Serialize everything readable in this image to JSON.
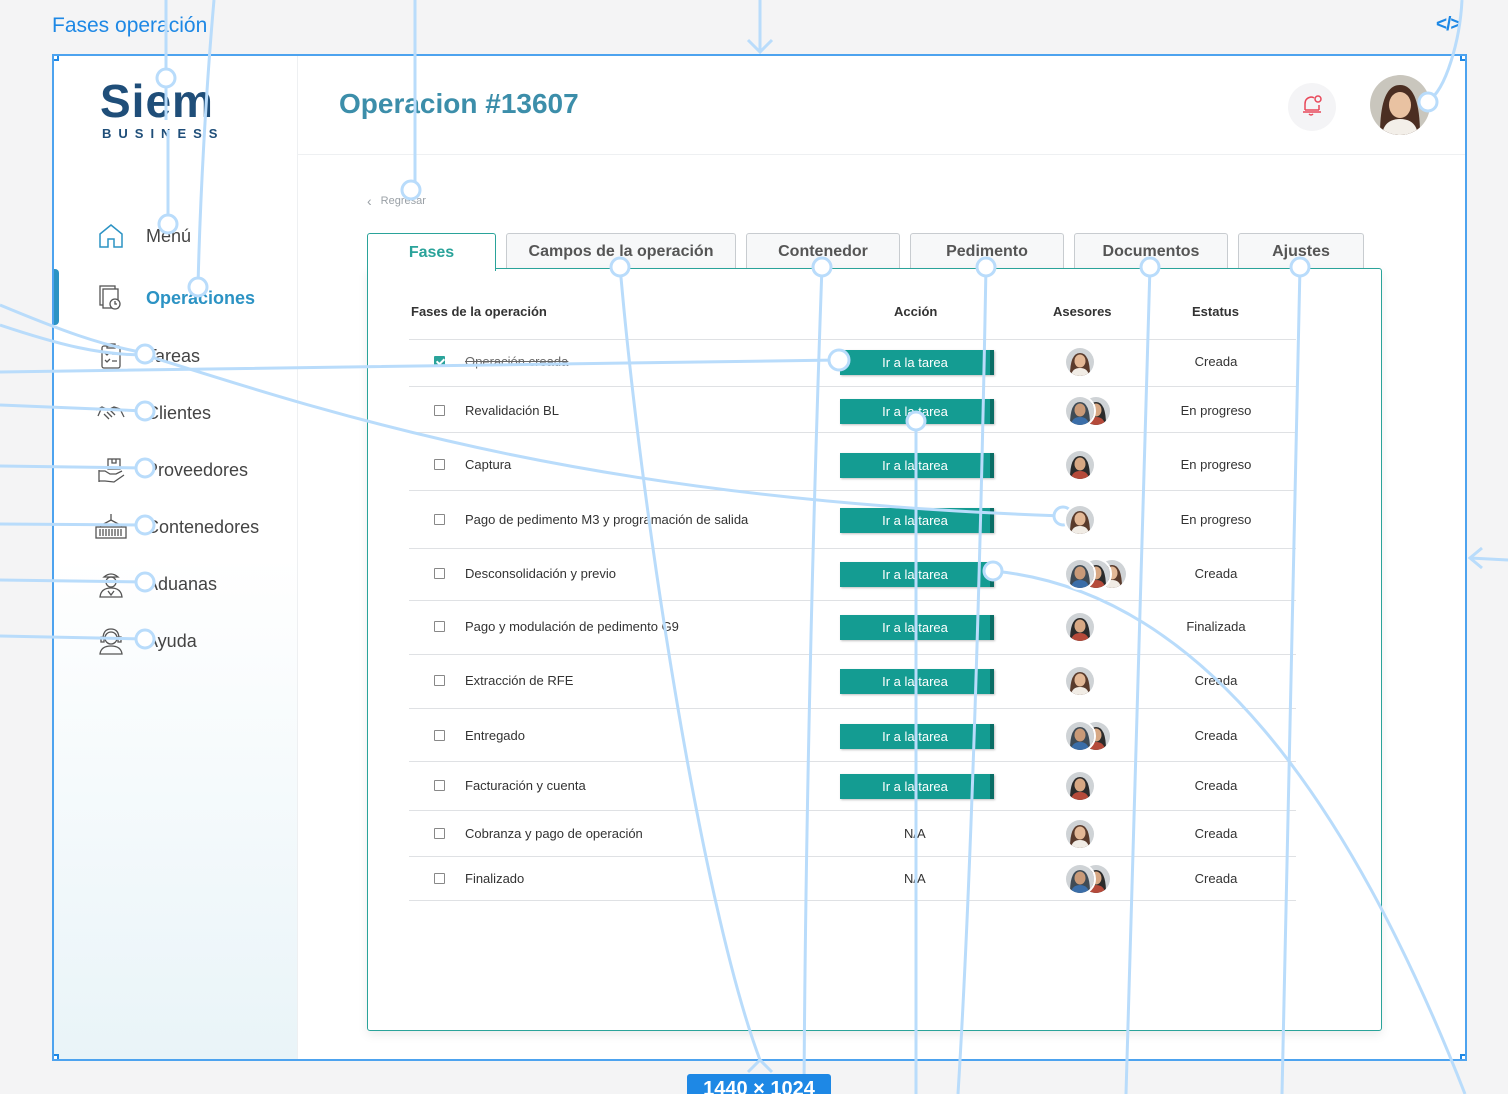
{
  "editor": {
    "frame_title": "Fases operación",
    "size_badge": "1440 × 1024",
    "accent_color": "#1e88e5"
  },
  "sidebar": {
    "logo_main": "Siem",
    "logo_sub": "BUSINESS",
    "items": [
      {
        "label": "Menú",
        "icon": "home-icon",
        "active": false
      },
      {
        "label": "Operaciones",
        "icon": "documents-clock-icon",
        "active": true
      },
      {
        "label": "Tareas",
        "icon": "clipboard-checklist-icon",
        "active": false
      },
      {
        "label": "Clientes",
        "icon": "handshake-icon",
        "active": false
      },
      {
        "label": "Proveedores",
        "icon": "hand-box-icon",
        "active": false
      },
      {
        "label": "Contenedores",
        "icon": "container-crane-icon",
        "active": false
      },
      {
        "label": "Aduanas",
        "icon": "customs-officer-icon",
        "active": false
      },
      {
        "label": "Ayuda",
        "icon": "support-agent-icon",
        "active": false
      }
    ]
  },
  "header": {
    "title": "Operacion #13607",
    "bell_icon": "bell-icon",
    "bell_color": "#e8485a"
  },
  "back_label": "Regresar",
  "tabs": [
    "Fases",
    "Campos de la operación",
    "Contenedor",
    "Pedimento",
    "Documentos",
    "Ajustes"
  ],
  "table": {
    "headers": {
      "phase": "Fases de la operación",
      "action": "Acción",
      "advisors": "Asesores",
      "status": "Estatus"
    },
    "task_button_label": "Ir a la tarea",
    "na_label": "N/A",
    "rows": [
      {
        "phase": "Operación creada",
        "checked": true,
        "action": "button",
        "advisors": 1,
        "status": "Creada"
      },
      {
        "phase": "Revalidación BL",
        "checked": false,
        "action": "button",
        "advisors": 2,
        "status": "En progreso"
      },
      {
        "phase": "Captura",
        "checked": false,
        "action": "button",
        "advisors": 1,
        "status": "En progreso"
      },
      {
        "phase": "Pago de pedimento M3 y programación de salida",
        "checked": false,
        "action": "button",
        "advisors": 1,
        "status": "En progreso"
      },
      {
        "phase": "Desconsolidación y previo",
        "checked": false,
        "action": "button",
        "advisors": 3,
        "status": "Creada"
      },
      {
        "phase": "Pago y modulación de pedimento G9",
        "checked": false,
        "action": "button",
        "advisors": 1,
        "status": "Finalizada"
      },
      {
        "phase": "Extracción de RFE",
        "checked": false,
        "action": "button",
        "advisors": 1,
        "status": "Creada"
      },
      {
        "phase": "Entregado",
        "checked": false,
        "action": "button",
        "advisors": 2,
        "status": "Creada"
      },
      {
        "phase": "Facturación y cuenta",
        "checked": false,
        "action": "button",
        "advisors": 1,
        "status": "Creada"
      },
      {
        "phase": "Cobranza y pago de operación",
        "checked": false,
        "action": "na",
        "advisors": 1,
        "status": "Creada"
      },
      {
        "phase": "Finalizado",
        "checked": false,
        "action": "na",
        "advisors": 2,
        "status": "Creada"
      }
    ]
  },
  "colors": {
    "primary_teal": "#149c92",
    "title_blue": "#3c8eaa",
    "nav_active": "#2c93c4",
    "logo_navy": "#1f4e79",
    "connector": "#b9dcfb"
  }
}
